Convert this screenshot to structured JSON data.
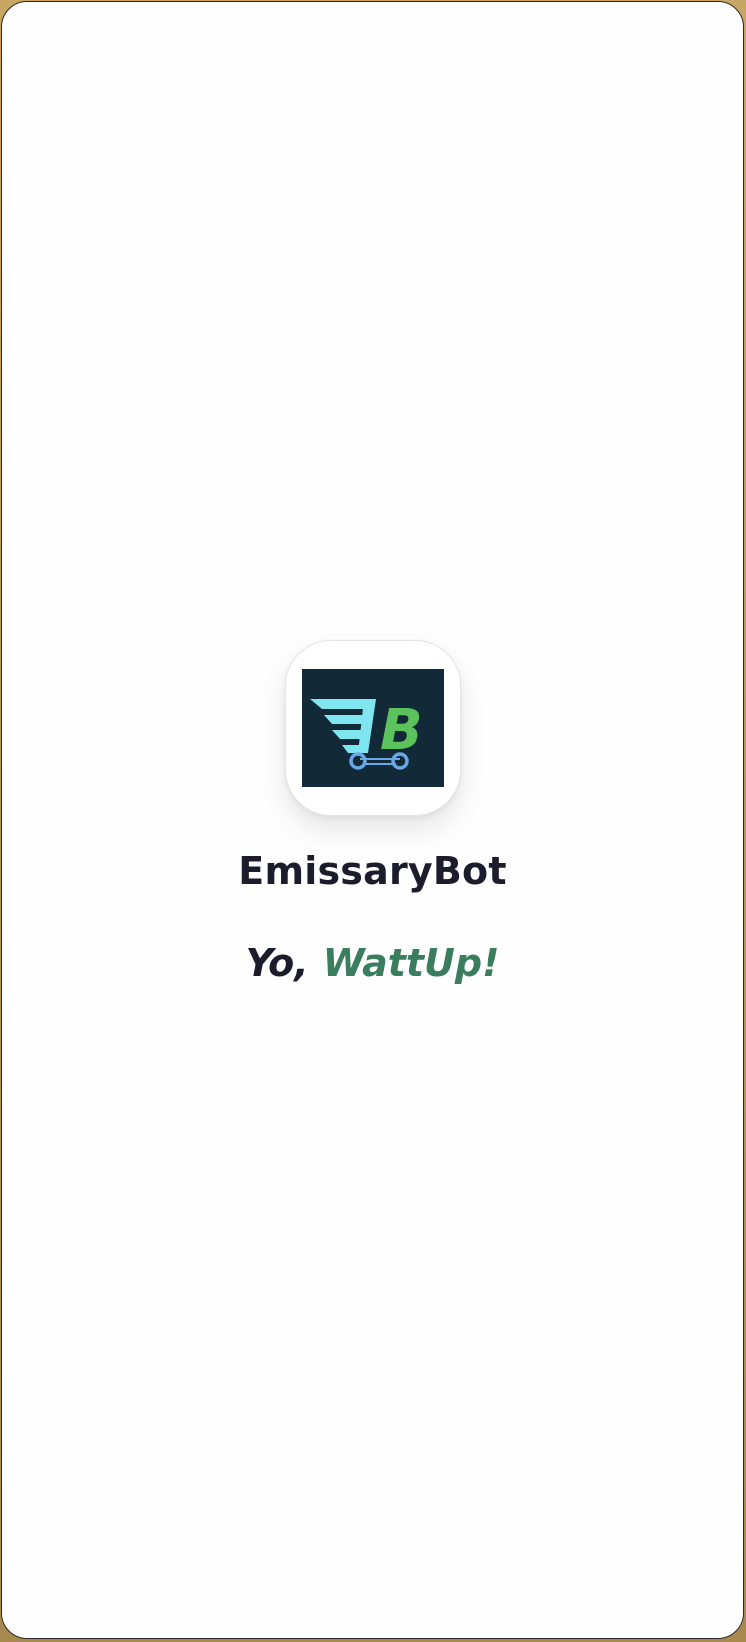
{
  "app": {
    "name": "EmissaryBot"
  },
  "logo": {
    "icon": "shopping-cart-b-logo",
    "letter": "B",
    "colors": {
      "background": "#122a37",
      "cart_lines": "#7fe6ef",
      "letter": "#5cc35c",
      "wheels": "#6aa7e6"
    }
  },
  "greeting": {
    "prefix": "Yo,",
    "accent": "WattUp!"
  },
  "colors": {
    "screen_background": "#fefefe",
    "text_primary": "#1c1c2c",
    "accent_green": "#3a7d5f"
  }
}
